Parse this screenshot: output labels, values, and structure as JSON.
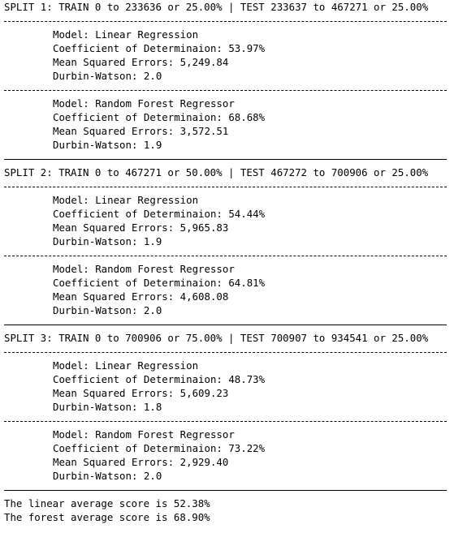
{
  "splits": [
    {
      "header": "SPLIT 1: TRAIN 0 to 233636 or 25.00% | TEST 233637 to 467271 or 25.00%",
      "models": [
        {
          "model": "Model: Linear Regression",
          "r2": "Coefficient of Determinaion: 53.97%",
          "mse": "Mean Squared Errors: 5,249.84",
          "dw": "Durbin-Watson: 2.0"
        },
        {
          "model": "Model: Random Forest Regressor",
          "r2": "Coefficient of Determinaion: 68.68%",
          "mse": "Mean Squared Errors: 3,572.51",
          "dw": "Durbin-Watson: 1.9"
        }
      ]
    },
    {
      "header": "SPLIT 2: TRAIN 0 to 467271 or 50.00% | TEST 467272 to 700906 or 25.00%",
      "models": [
        {
          "model": "Model: Linear Regression",
          "r2": "Coefficient of Determinaion: 54.44%",
          "mse": "Mean Squared Errors: 5,965.83",
          "dw": "Durbin-Watson: 1.9"
        },
        {
          "model": "Model: Random Forest Regressor",
          "r2": "Coefficient of Determinaion: 64.81%",
          "mse": "Mean Squared Errors: 4,608.08",
          "dw": "Durbin-Watson: 2.0"
        }
      ]
    },
    {
      "header": "SPLIT 3: TRAIN 0 to 700906 or 75.00% | TEST 700907 to 934541 or 25.00%",
      "models": [
        {
          "model": "Model: Linear Regression",
          "r2": "Coefficient of Determinaion: 48.73%",
          "mse": "Mean Squared Errors: 5,609.23",
          "dw": "Durbin-Watson: 1.8"
        },
        {
          "model": "Model: Random Forest Regressor",
          "r2": "Coefficient of Determinaion: 73.22%",
          "mse": "Mean Squared Errors: 2,929.40",
          "dw": "Durbin-Watson: 2.0"
        }
      ]
    }
  ],
  "summary": {
    "linear": "The linear average score is 52.38%",
    "forest": "The forest average score is 68.90%"
  }
}
